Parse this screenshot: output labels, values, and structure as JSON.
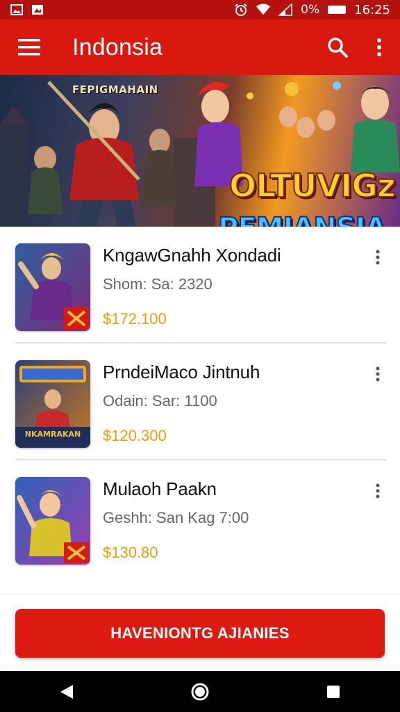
{
  "status_bar": {
    "battery_pct": "0%",
    "time": "16:25",
    "icons": [
      "gallery-icon",
      "image-icon",
      "alarm-icon",
      "wifi-icon",
      "signal-icon",
      "battery-icon"
    ]
  },
  "app_bar": {
    "title": "Indonsia",
    "icons": [
      "menu-icon",
      "search-icon",
      "more-vertical-icon"
    ]
  },
  "banner": {
    "small_text": "FEPIGMAHAIN",
    "title_line1": "OLTUVIGz",
    "title_line2": "PEMIANSIA"
  },
  "items": [
    {
      "title": "KngawGnahh Xondadi",
      "subtitle": "Shom: Sa: 2320",
      "price": "$172.100",
      "thumb_colors": [
        "#2f5f9e",
        "#7b2b7a"
      ],
      "thumb_caption": ""
    },
    {
      "title": "PrndeiMaco Jintnuh",
      "subtitle": "Odain: Sar: 1100",
      "price": "$120.300",
      "thumb_colors": [
        "#2b3f7a",
        "#c7781f"
      ],
      "thumb_caption": "NKAMRAKAN"
    },
    {
      "title": "Mulaoh Paakn",
      "subtitle": "Geshh: San Kag 7:00",
      "price": "$130.80",
      "thumb_colors": [
        "#2f62b8",
        "#9b3fb0"
      ],
      "thumb_caption": ""
    }
  ],
  "cta": {
    "label": "HAVENIONTG AJIANIES"
  },
  "nav": {
    "icons": [
      "back-icon",
      "home-icon",
      "recents-icon"
    ]
  },
  "colors": {
    "status_bar": "#b5110f",
    "app_bar": "#d9180f",
    "price": "#e4a10f",
    "cta": "#dd1a12"
  }
}
